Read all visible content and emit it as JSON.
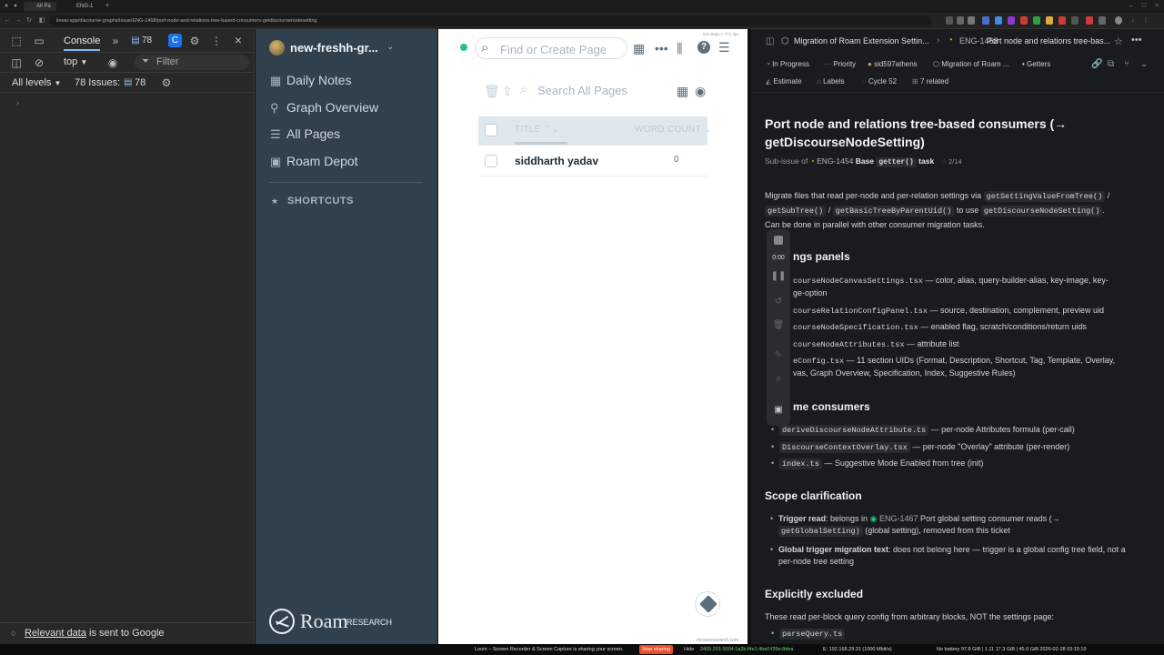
{
  "browser": {
    "tabs": [
      "All Pa",
      "ENG-1"
    ],
    "url": "linear.app/discourse-graphs/issue/ENG-1468/port-node-and-relations-tree-based-consumers-getdiscoursenodesetting"
  },
  "devtools": {
    "tab_console": "Console",
    "issues_badge": "78",
    "context": "top",
    "filter_placeholder": "Filter",
    "levels": "All levels",
    "issues_label": "78 Issues:",
    "issues_count": "78",
    "footer_link": "Relevant data",
    "footer_text": "is sent to Google"
  },
  "roam_sidebar": {
    "graph_name": "new-freshh-gr...",
    "items": [
      {
        "label": "Daily Notes",
        "icon": "calendar-icon"
      },
      {
        "label": "Graph Overview",
        "icon": "graph-icon"
      },
      {
        "label": "All Pages",
        "icon": "list-icon"
      },
      {
        "label": "Roam Depot",
        "icon": "store-icon"
      }
    ],
    "shortcuts": "SHORTCUTS",
    "logo_text": "Roam",
    "logo_sub": "RESEARCH"
  },
  "roam_main": {
    "find_placeholder": "Find or Create Page",
    "search_placeholder": "Search All Pages",
    "col_title": "TITLE",
    "col_word_count": "WORD COUNT",
    "rows": [
      {
        "title": "siddharth yadav",
        "word_count": "0"
      }
    ],
    "dimension_readout": "621.69px × 771.4px"
  },
  "linear": {
    "breadcrumb_parent": "Migration of Roam Extension Settin...",
    "breadcrumb_id": "ENG-1468",
    "breadcrumb_title": "Port node and relations tree-bas...",
    "props": {
      "status": "In Progress",
      "priority": "Priority",
      "assignee": "sid597athens",
      "project": "Migration of Roam ...",
      "label_tag": "Getters",
      "estimate": "Estimate",
      "labels": "Labels",
      "cycle": "Cycle 52",
      "related": "7 related"
    },
    "title_line1": "Port node and relations tree-based consumers (→",
    "title_line2": "getDiscourseNodeSetting)",
    "subissue_prefix": "Sub-issue of",
    "parent_id": "ENG-1454",
    "parent_title_a": "Base",
    "parent_code": "getter()",
    "parent_title_b": "task",
    "parent_progress": "2/14",
    "intro_a": "Migrate files that read per-node and per-relation settings via",
    "intro_code1": "getSettingValueFromTree()",
    "intro_slash": "/",
    "intro_code2": "getSubTree()",
    "intro_code3": "getBasicTreeByParentUid()",
    "intro_to_use": "to use",
    "intro_code4": "getDiscourseNodeSetting()",
    "intro_end": ".",
    "parallel": "Can be done in parallel with other consumer migration tasks.",
    "h_settings": "ngs panels",
    "settings_items": [
      {
        "code": "courseNodeCanvasSettings.tsx",
        "text": "— color, alias, query-builder-alias, key-image, key-",
        "text2": "ge-option"
      },
      {
        "code": "courseRelationConfigPanel.tsx",
        "text": "— source, destination, complement, preview uid"
      },
      {
        "code": "courseNodeSpecification.tsx",
        "text": "— enabled flag, scratch/conditions/return uids"
      },
      {
        "code": "courseNodeAttributes.tsx",
        "text": "— attribute list"
      },
      {
        "code": "eConfig.tsx",
        "text": "— 11 section UIDs (Format, Description, Shortcut, Tag, Template, Overlay,",
        "text2": "vas, Graph Overview, Specification, Index, Suggestive Rules)"
      }
    ],
    "h_runtime": "me consumers",
    "runtime_items": [
      {
        "code": "deriveDiscourseNodeAttribute.ts",
        "text": "— per-node Attributes formula (per-call)"
      },
      {
        "code": "DiscourseContextOverlay.tsx",
        "text": "— per-node \"Overlay\" attribute (per-render)"
      },
      {
        "code": "index.ts",
        "text": "— Suggestive Mode Enabled from tree (init)"
      }
    ],
    "h_scope": "Scope clarification",
    "scope_trigger_bold": "Trigger read",
    "scope_trigger_a": ": belongs in",
    "scope_trigger_id": "ENG-1467",
    "scope_trigger_b": "Port global setting consumer reads (→",
    "scope_trigger_code": "getGlobalSetting)",
    "scope_trigger_c": "(global setting), removed from this ticket",
    "scope_global_bold": "Global trigger migration text",
    "scope_global_a": ": does not belong here — trigger is a global config tree field, not a",
    "scope_global_b": "per-node tree setting",
    "h_excluded": "Explicitly excluded",
    "excluded_text": "These read per-block query config from arbitrary blocks, NOT the settings page:",
    "excluded_code": "parseQuery.ts"
  },
  "recorder": {
    "time": "0:00"
  },
  "statusbar": {
    "center": "Loom – Screen Recorder & Screen Capture is sharing your screen.",
    "stop": "Stop sharing",
    "hide": "Hide",
    "right": "No battery 97.8 GiB | 1.11 17.3 GiB | 45.0 GiB 2026-02-28 03:15:10",
    "left": "2405:201:5004:1a2b:f4e1:4be0:f39e:8dea",
    "ip": "E: 192.168.29.31 (1000 Mbit/s)",
    "url": "...mroamresearch.com"
  },
  "colors": {
    "roam_sidebar_bg": "#30404d",
    "linear_bg": "#1a1b1e",
    "devtools_bg": "#282828",
    "accent_green": "#2ec27e",
    "stop_red": "#e84f2b"
  }
}
